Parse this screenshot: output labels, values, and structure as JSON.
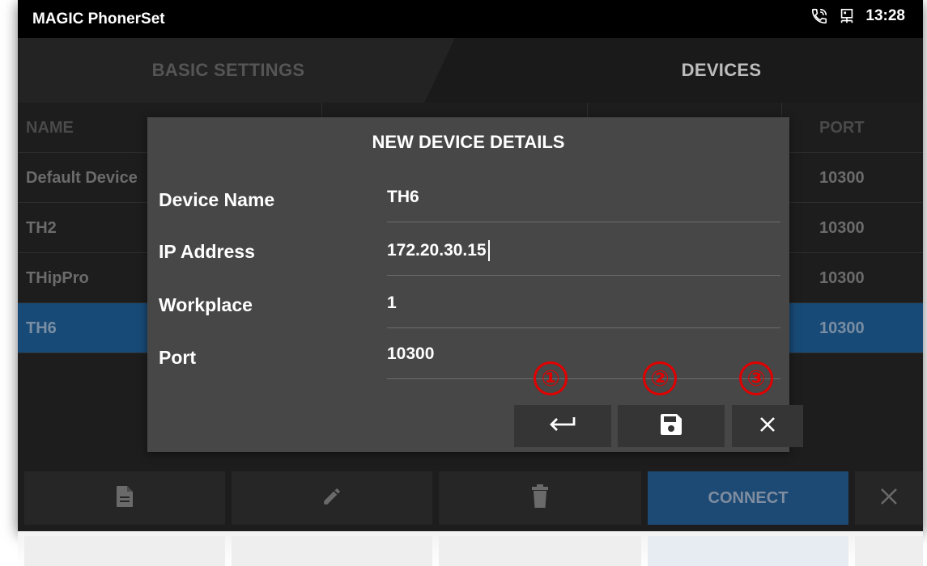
{
  "statusbar": {
    "app_title": "MAGIC PhonerSet",
    "time": "13:28",
    "icons": [
      "phone-active-icon",
      "network-icon"
    ]
  },
  "tabs": [
    {
      "label": "BASIC SETTINGS",
      "active": false
    },
    {
      "label": "DEVICES",
      "active": true
    }
  ],
  "table": {
    "columns": {
      "name": "NAME",
      "port": "PORT"
    },
    "rows": [
      {
        "name": "Default Device",
        "port": "10300",
        "selected": false
      },
      {
        "name": "TH2",
        "port": "10300",
        "selected": false
      },
      {
        "name": "THipPro",
        "port": "10300",
        "selected": false
      },
      {
        "name": "TH6",
        "port": "10300",
        "selected": true
      }
    ]
  },
  "dialog": {
    "title": "NEW DEVICE DETAILS",
    "fields": [
      {
        "label": "Device Name",
        "value": "TH6"
      },
      {
        "label": "IP Address",
        "value": "172.20.30.15"
      },
      {
        "label": "Workplace",
        "value": "1"
      },
      {
        "label": "Port",
        "value": "10300"
      }
    ],
    "buttons": [
      {
        "icon": "return-arrow-icon",
        "marker": "①"
      },
      {
        "icon": "save-floppy-icon",
        "marker": "②"
      },
      {
        "icon": "close-icon",
        "marker": "③"
      }
    ]
  },
  "toolbar": {
    "icons": [
      "new-file-icon",
      "edit-pencil-icon",
      "trash-icon",
      "close-icon"
    ],
    "connect_label": "CONNECT"
  },
  "colors": {
    "accent_blue": "#184a77",
    "dialog_bg": "#474747",
    "marker_red": "#e00000"
  }
}
